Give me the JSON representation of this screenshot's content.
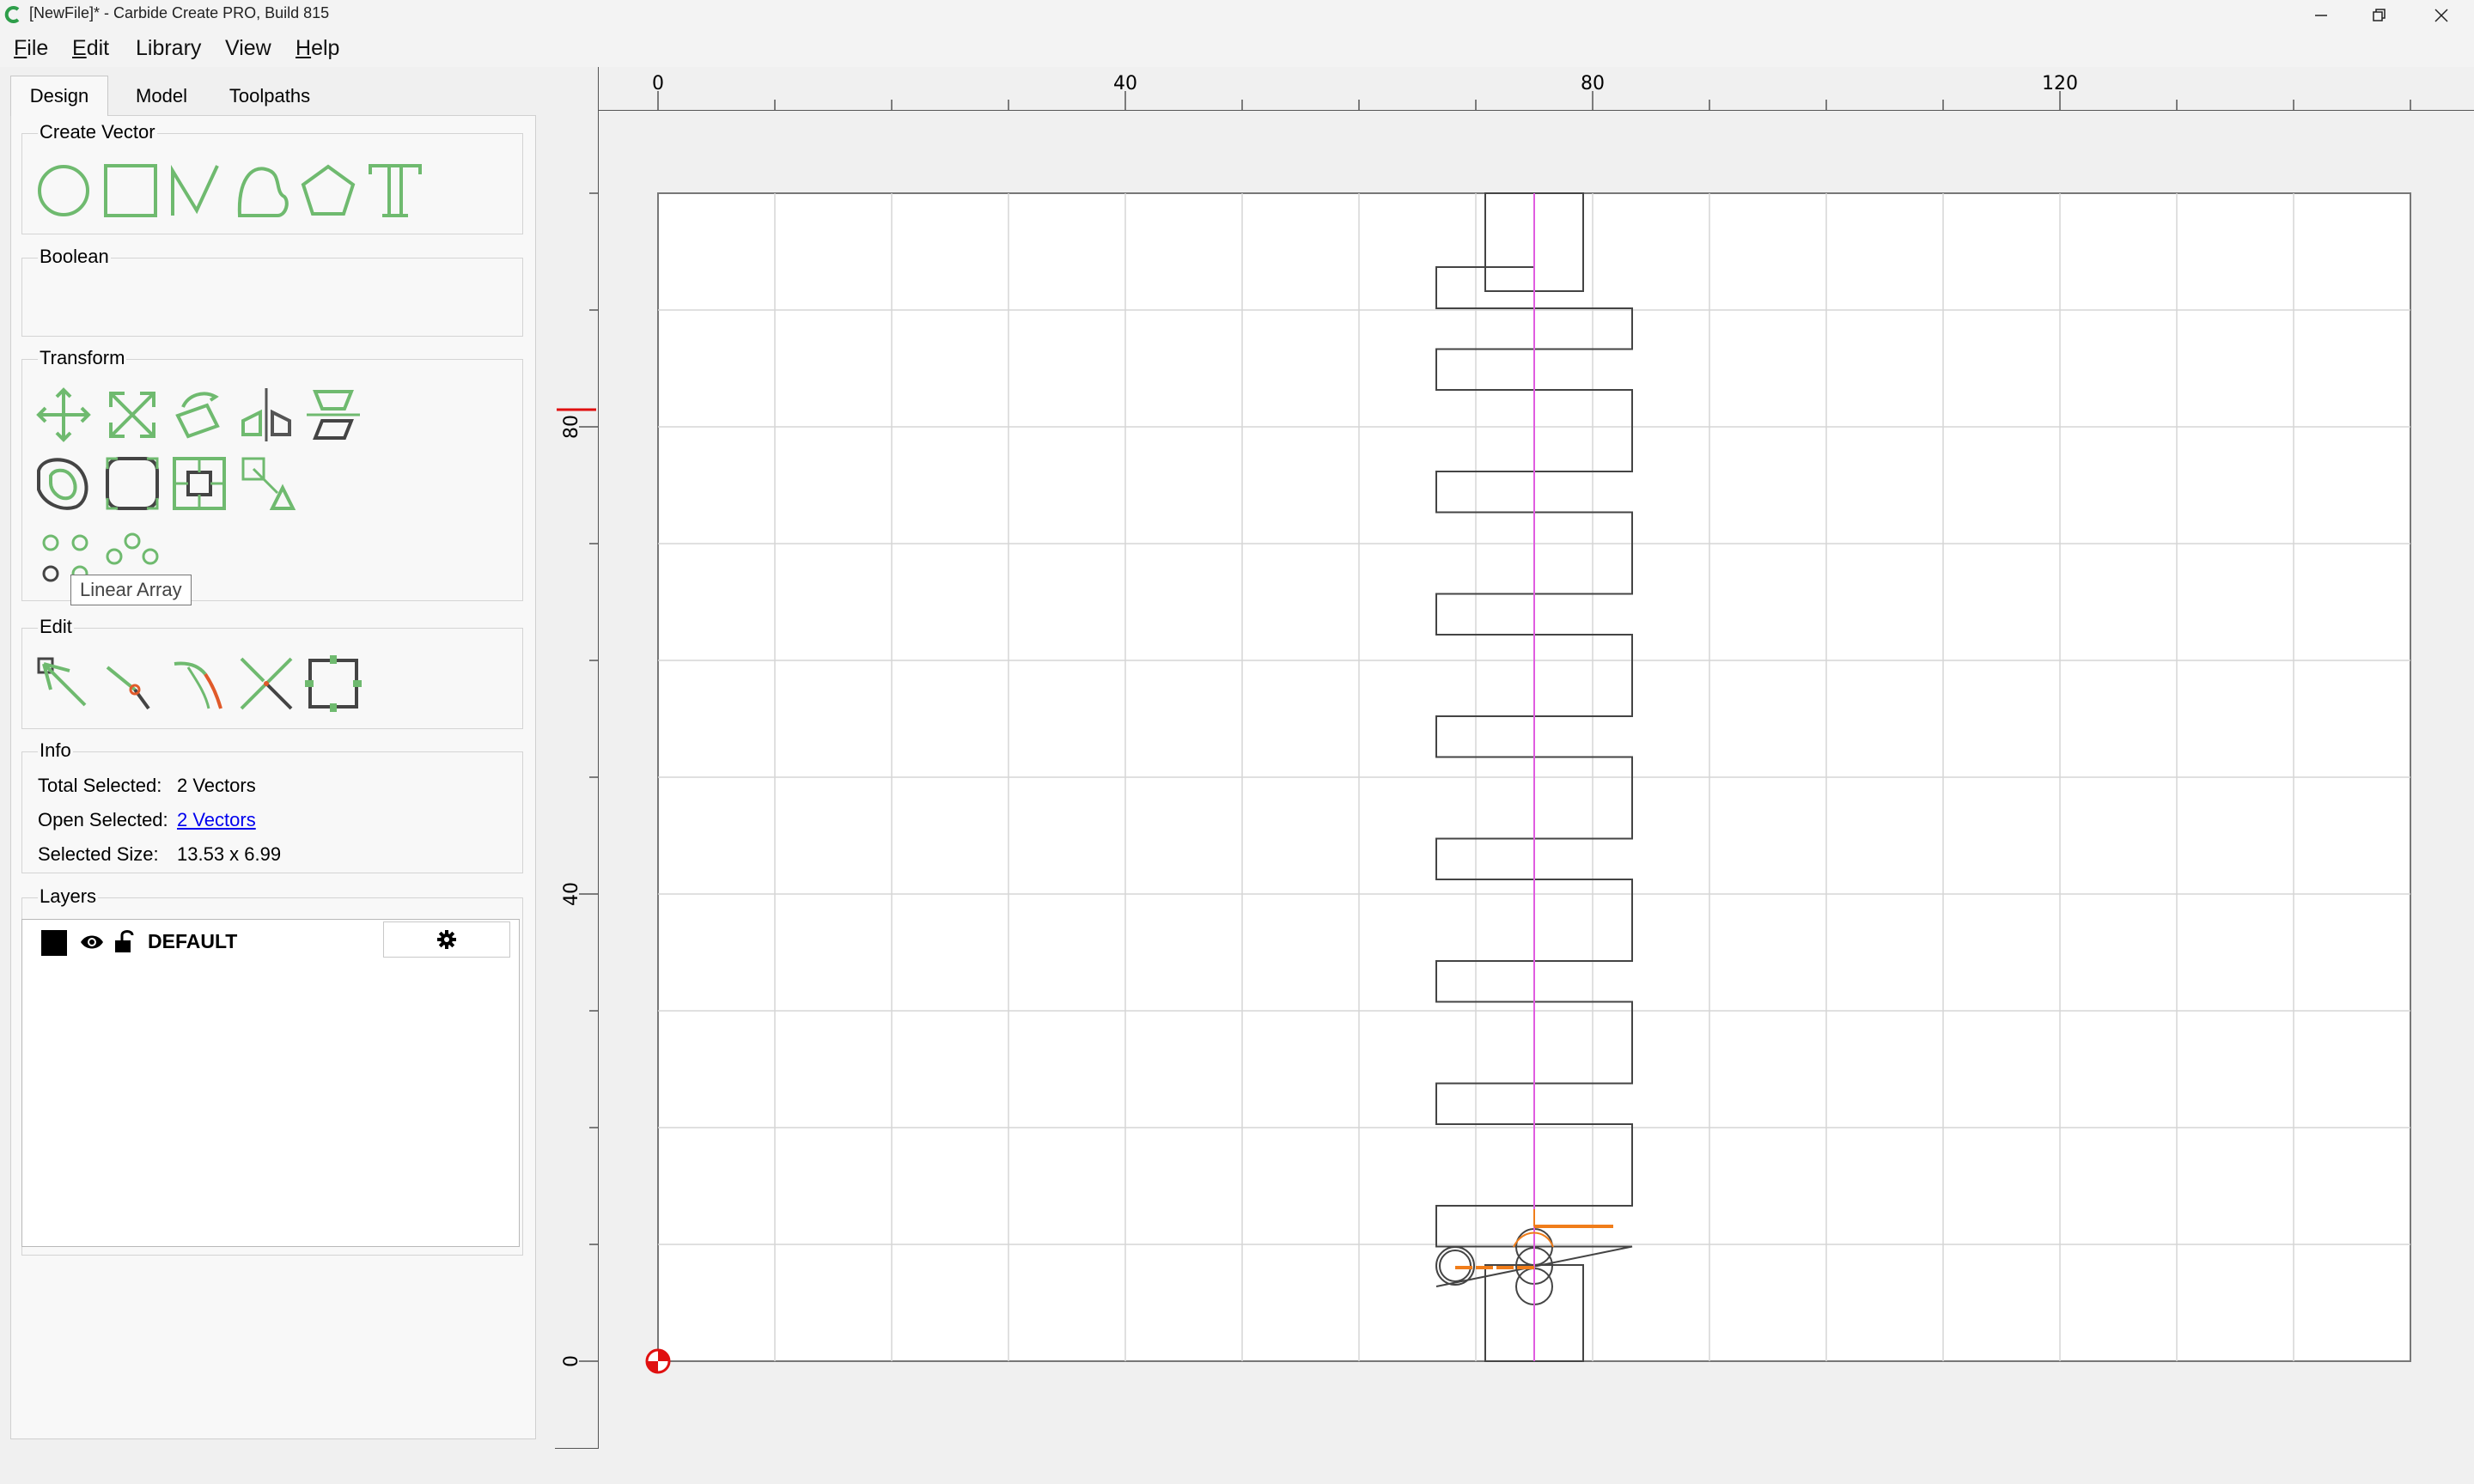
{
  "window": {
    "title": "[NewFile]* - Carbide Create PRO, Build 815",
    "app_icon": "carbide-logo-icon",
    "controls": [
      "minimize-icon",
      "restore-icon",
      "close-icon"
    ]
  },
  "menu": {
    "items": [
      {
        "label": "File",
        "key": "F",
        "rest": "ile"
      },
      {
        "label": "Edit",
        "key": "E",
        "rest": "dit"
      },
      {
        "label": "Library",
        "key": "",
        "rest": "Library"
      },
      {
        "label": "View",
        "key": "",
        "rest": "View"
      },
      {
        "label": "Help",
        "key": "H",
        "rest": "elp"
      }
    ]
  },
  "tabs": [
    {
      "label": "Design",
      "active": true
    },
    {
      "label": "Model",
      "active": false
    },
    {
      "label": "Toolpaths",
      "active": false
    }
  ],
  "groups": {
    "create_vector": {
      "title": "Create Vector",
      "tools": [
        "circle-icon",
        "rectangle-icon",
        "polyline-icon",
        "curve-icon",
        "polygon-icon",
        "text-icon"
      ]
    },
    "boolean": {
      "title": "Boolean"
    },
    "transform": {
      "title": "Transform",
      "tools_row1": [
        "move-icon",
        "scale-icon",
        "rotate-icon",
        "mirror-icon",
        "align-icon"
      ],
      "tools_row2": [
        "offset-icon",
        "fillet-icon",
        "bounding-box-icon",
        "fit-icon"
      ],
      "tools_row3": [
        "linear-array-icon",
        "circular-array-icon"
      ],
      "tooltip": "Linear Array"
    },
    "edit": {
      "title": "Edit",
      "tools": [
        "node-edit-icon",
        "split-icon",
        "join-icon",
        "trim-icon",
        "bounding-edit-icon"
      ]
    },
    "info": {
      "title": "Info",
      "total_selected_label": "Total Selected:",
      "total_selected_value": "2 Vectors",
      "open_selected_label": "Open Selected:",
      "open_selected_value": "2 Vectors",
      "selected_size_label": "Selected Size:",
      "selected_size_value": "13.53 x 6.99"
    },
    "layers": {
      "title": "Layers",
      "items": [
        {
          "name": "DEFAULT",
          "color": "#000000",
          "visible_icon": "eye-icon",
          "lock_icon": "unlocked-icon",
          "settings_icon": "gear-icon"
        }
      ]
    }
  },
  "rulers": {
    "horizontal_labels": [
      "0",
      "40",
      "80",
      "120"
    ],
    "vertical_labels": [
      "80",
      "40",
      "0"
    ]
  },
  "canvas": {
    "stock_width": 150,
    "stock_height": 100,
    "grid_spacing": 10,
    "origin_icon": "origin-marker-icon",
    "colors": {
      "accent": "#6fba6f",
      "selection": "#f07d1a",
      "centerline": "#e05ce0",
      "origin": "#e01010"
    }
  }
}
